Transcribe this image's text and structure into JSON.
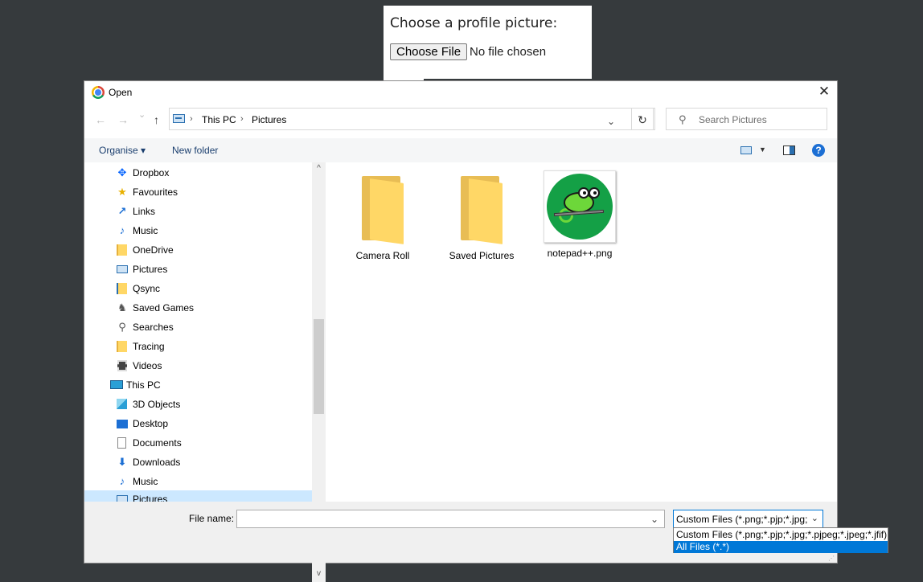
{
  "page": {
    "label": "Choose a profile picture:",
    "choose_file_button": "Choose File",
    "no_file_text": "No file chosen"
  },
  "dialog": {
    "title": "Open",
    "close_glyph": "✕",
    "nav": {
      "back_glyph": "←",
      "forward_glyph": "→",
      "recent_glyph": "⌄",
      "up_glyph": "↑",
      "breadcrumb": [
        "This PC",
        "Pictures"
      ],
      "separator": "›",
      "dropdown_glyph": "⌄",
      "refresh_glyph": "↻",
      "search_placeholder": "Search Pictures"
    },
    "toolbar": {
      "organise": "Organise ▾",
      "new_folder": "New folder",
      "view_dropdown": "▼",
      "help": "?"
    },
    "tree": [
      {
        "label": "Dropbox",
        "icon": "dropbox-icon"
      },
      {
        "label": "Favourites",
        "icon": "star-icon"
      },
      {
        "label": "Links",
        "icon": "link-icon"
      },
      {
        "label": "Music",
        "icon": "music-icon"
      },
      {
        "label": "OneDrive",
        "icon": "folder-icon"
      },
      {
        "label": "Pictures",
        "icon": "pictures-icon"
      },
      {
        "label": "Qsync",
        "icon": "qsync-icon"
      },
      {
        "label": "Saved Games",
        "icon": "saved-games-icon"
      },
      {
        "label": "Searches",
        "icon": "search-icon"
      },
      {
        "label": "Tracing",
        "icon": "folder-icon"
      },
      {
        "label": "Videos",
        "icon": "videos-icon"
      },
      {
        "label": "This PC",
        "icon": "pc-icon"
      },
      {
        "label": "3D Objects",
        "icon": "3d-objects-icon"
      },
      {
        "label": "Desktop",
        "icon": "desktop-icon"
      },
      {
        "label": "Documents",
        "icon": "documents-icon"
      },
      {
        "label": "Downloads",
        "icon": "downloads-icon"
      },
      {
        "label": "Music",
        "icon": "music-icon"
      },
      {
        "label": "Pictures",
        "icon": "pictures-icon"
      }
    ],
    "scroll_up_glyph": "^",
    "scroll_down_glyph": "v",
    "files": [
      {
        "name": "Camera Roll",
        "type": "folder"
      },
      {
        "name": "Saved Pictures",
        "type": "folder"
      },
      {
        "name": "notepad++.png",
        "type": "image"
      }
    ],
    "bottom": {
      "filename_label": "File name:",
      "filename_value": "",
      "filename_dropdown": "⌄",
      "filetype_selected": "Custom Files (*.png;*.pjp;*.jpg;",
      "filetype_arrow": "⌄",
      "filetype_options": [
        "Custom Files (*.png;*.pjp;*.jpg;*.pjpeg;*.jpeg;*.jfif)",
        "All Files (*.*)"
      ],
      "resize_grip": "⋰"
    }
  },
  "colors": {
    "background": "#363a3d",
    "accent": "#0078d7",
    "selection": "#cce8ff"
  }
}
